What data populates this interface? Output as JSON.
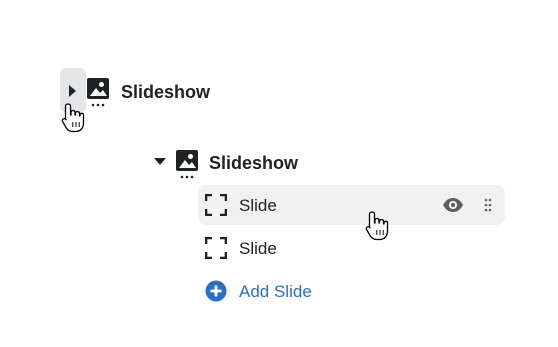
{
  "tree": {
    "collapsed_section": {
      "label": "Slideshow",
      "icon": "image-icon",
      "toggle_icon": "caret-right-icon",
      "state": "collapsed"
    },
    "expanded_section": {
      "label": "Slideshow",
      "icon": "image-icon",
      "toggle_icon": "caret-down-icon",
      "state": "expanded",
      "blocks": [
        {
          "label": "Slide",
          "icon": "frame-icon",
          "selected": true,
          "actions": [
            "eye-icon",
            "drag-handle-icon"
          ]
        },
        {
          "label": "Slide",
          "icon": "frame-icon",
          "selected": false
        }
      ],
      "add_block": {
        "label": "Add Slide",
        "icon": "add-circle-icon"
      }
    }
  },
  "colors": {
    "text": "#202223",
    "icon": "#5c5f62",
    "link": "#2c6ecb",
    "selected_row_bg": "#f1f1f1",
    "hover_bg": "#e4e5e7"
  }
}
